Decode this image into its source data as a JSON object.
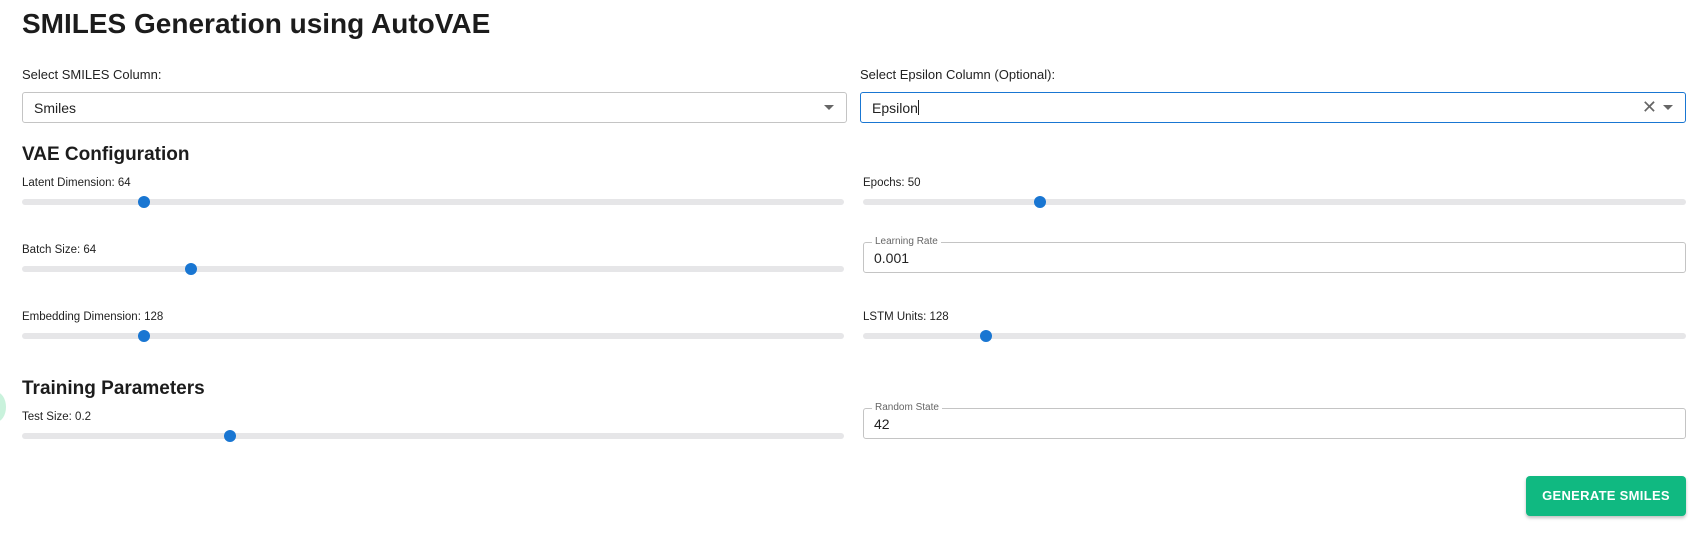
{
  "page": {
    "title": "SMILES Generation using AutoVAE"
  },
  "smiles_column": {
    "label": "Select SMILES Column:",
    "value": "Smiles"
  },
  "epsilon_column": {
    "label": "Select Epsilon Column (Optional):",
    "value": "Epsilon"
  },
  "vae_config": {
    "heading": "VAE Configuration",
    "latent_dimension": {
      "label": "Latent Dimension: 64",
      "value": 64,
      "fraction": 0.148
    },
    "epochs": {
      "label": "Epochs: 50",
      "value": 50,
      "fraction": 0.215
    },
    "batch_size": {
      "label": "Batch Size: 64",
      "value": 64,
      "fraction": 0.205
    },
    "learning_rate": {
      "label": "Learning Rate",
      "value": "0.001"
    },
    "embedding_dimension": {
      "label": "Embedding Dimension: 128",
      "value": 128,
      "fraction": 0.148
    },
    "lstm_units": {
      "label": "LSTM Units: 128",
      "value": 128,
      "fraction": 0.149
    }
  },
  "training": {
    "heading": "Training Parameters",
    "test_size": {
      "label": "Test Size: 0.2",
      "value": 0.2,
      "fraction": 0.253
    },
    "random_state": {
      "label": "Random State",
      "value": "42"
    }
  },
  "actions": {
    "generate_label": "GENERATE SMILES"
  },
  "colors": {
    "accent": "#1976d2",
    "button": "#10b981",
    "rail": "#e6e6e8"
  }
}
